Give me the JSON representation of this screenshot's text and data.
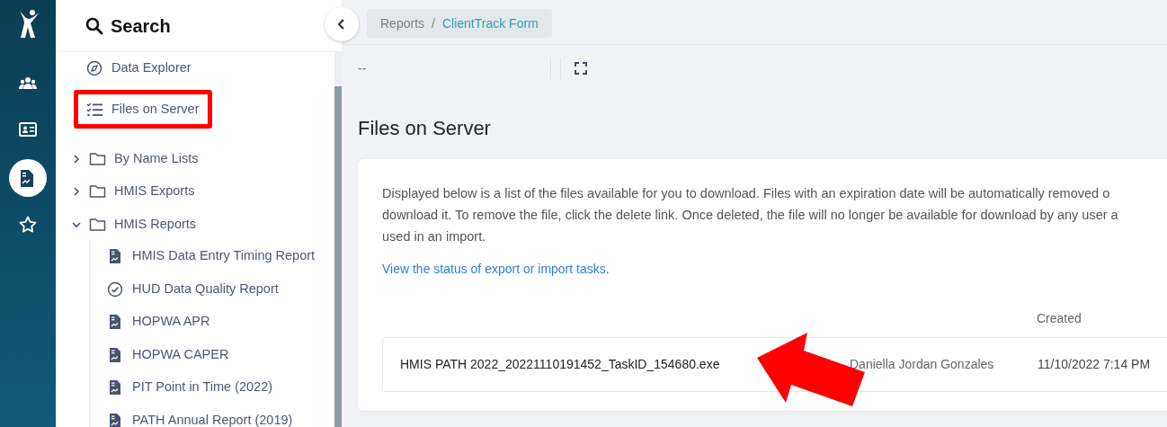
{
  "rail": {
    "items": [
      {
        "kind": "people",
        "selected": false
      },
      {
        "kind": "id-card",
        "selected": false
      },
      {
        "kind": "report",
        "selected": true
      },
      {
        "kind": "star",
        "selected": false
      }
    ]
  },
  "sidebar": {
    "search_title": "Search",
    "items": [
      {
        "kind": "explorer",
        "label": "Data Explorer",
        "highlighted": false
      },
      {
        "kind": "checklist",
        "label": "Files on Server",
        "highlighted": true
      },
      {
        "kind": "folder",
        "label": "By Name Lists",
        "expanded": false
      },
      {
        "kind": "folder",
        "label": "HMIS Exports",
        "expanded": false
      },
      {
        "kind": "folder",
        "label": "HMIS Reports",
        "expanded": true,
        "children": [
          {
            "kind": "report",
            "label": "HMIS Data Entry Timing Report"
          },
          {
            "kind": "check",
            "label": "HUD Data Quality Report"
          },
          {
            "kind": "report",
            "label": "HOPWA APR"
          },
          {
            "kind": "report",
            "label": "HOPWA CAPER"
          },
          {
            "kind": "report",
            "label": "PIT Point in Time (2022)"
          },
          {
            "kind": "report",
            "label": "PATH Annual Report (2019)"
          }
        ]
      }
    ]
  },
  "breadcrumb_separator": "/",
  "breadcrumb": [
    {
      "label": "Reports",
      "current": false
    },
    {
      "label": "ClientTrack Form",
      "current": true
    }
  ],
  "toolbar": {
    "value": "--"
  },
  "page_title": "Files on Server",
  "card": {
    "description": "Displayed below is a list of the files available for you to download. Files with an expiration date will be automatically removed o\ndownload it. To remove the file, click the delete link. Once deleted, the file will no longer be available for download by any user a\nused in an import.",
    "link": "View the status of export or import tasks",
    "link_suffix": ".",
    "table": {
      "created_header": "Created",
      "rows": [
        {
          "file_name": "HMIS PATH 2022_20221110191452_TaskID_154680.exe",
          "column_2": "Daniella Jordan Gonzales",
          "created": "11/10/2022 7:14 PM"
        }
      ]
    }
  },
  "annotations": [
    {
      "kind": "arrow"
    }
  ]
}
